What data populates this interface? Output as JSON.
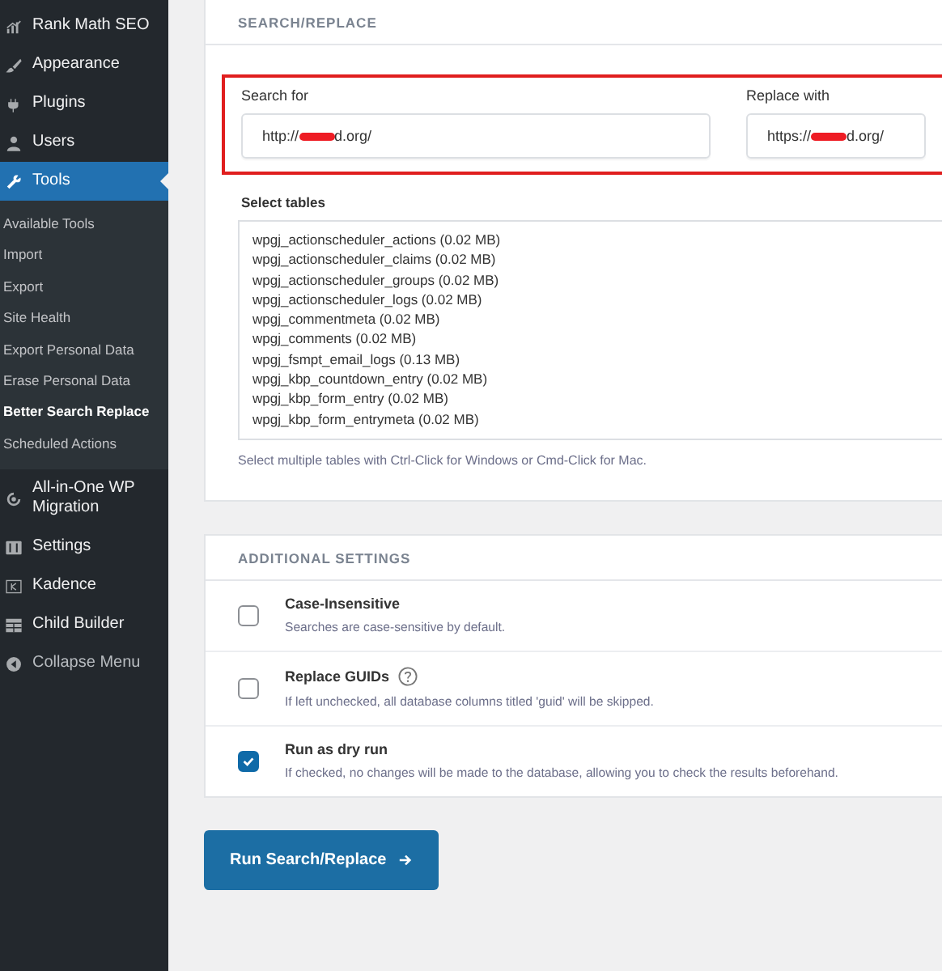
{
  "sidebar": {
    "items": [
      {
        "label": "Rank Math SEO",
        "selected": false
      },
      {
        "label": "Appearance",
        "selected": false
      },
      {
        "label": "Plugins",
        "selected": false
      },
      {
        "label": "Users",
        "selected": false
      },
      {
        "label": "Tools",
        "selected": true,
        "children": [
          {
            "label": "Available Tools",
            "selected": false
          },
          {
            "label": "Import",
            "selected": false
          },
          {
            "label": "Export",
            "selected": false
          },
          {
            "label": "Site Health",
            "selected": false
          },
          {
            "label": "Export Personal Data",
            "selected": false
          },
          {
            "label": "Erase Personal Data",
            "selected": false
          },
          {
            "label": "Better Search Replace",
            "selected": true
          },
          {
            "label": "Scheduled Actions",
            "selected": false
          }
        ]
      },
      {
        "label": "All-in-One WP Migration",
        "selected": false
      },
      {
        "label": "Settings",
        "selected": false
      },
      {
        "label": "Kadence",
        "selected": false
      },
      {
        "label": "Child Builder",
        "selected": false
      },
      {
        "label": "Collapse Menu",
        "selected": false
      }
    ]
  },
  "search_replace": {
    "heading": "SEARCH/REPLACE",
    "search_for": {
      "label": "Search for",
      "value_start": "http://",
      "value_end": "d.org/",
      "redacted": true
    },
    "replace_with": {
      "label": "Replace with",
      "value_start": "https://",
      "value_end": "d.org/",
      "redacted": true
    },
    "highlighted": true,
    "tables_label": "Select tables",
    "tables": [
      {
        "name": "wpgj_actionscheduler_actions (0.02 MB)",
        "selected": false
      },
      {
        "name": "wpgj_actionscheduler_claims (0.02 MB)",
        "selected": false
      },
      {
        "name": "wpgj_actionscheduler_groups (0.02 MB)",
        "selected": false
      },
      {
        "name": "wpgj_actionscheduler_logs (0.02 MB)",
        "selected": false
      },
      {
        "name": "wpgj_commentmeta (0.02 MB)",
        "selected": false
      },
      {
        "name": "wpgj_comments (0.02 MB)",
        "selected": false
      },
      {
        "name": "wpgj_fsmpt_email_logs (0.13 MB)",
        "selected": false
      },
      {
        "name": "wpgj_kbp_countdown_entry (0.02 MB)",
        "selected": false
      },
      {
        "name": "wpgj_kbp_form_entry (0.02 MB)",
        "selected": false
      },
      {
        "name": "wpgj_kbp_form_entrymeta (0.02 MB)",
        "selected": false
      }
    ],
    "tables_help": "Select multiple tables with Ctrl-Click for Windows or Cmd-Click for Mac."
  },
  "additional_settings": {
    "heading": "ADDITIONAL SETTINGS",
    "options": [
      {
        "label": "Case-Insensitive",
        "description": "Searches are case-sensitive by default.",
        "checked": false,
        "help": false
      },
      {
        "label": "Replace GUIDs",
        "description": "If left unchecked, all database columns titled 'guid' will be skipped.",
        "checked": false,
        "help": true
      },
      {
        "label": "Run as dry run",
        "description": "If checked, no changes will be made to the database, allowing you to check the results beforehand.",
        "checked": true,
        "help": false
      }
    ]
  },
  "run_button": {
    "label": "Run Search/Replace"
  }
}
